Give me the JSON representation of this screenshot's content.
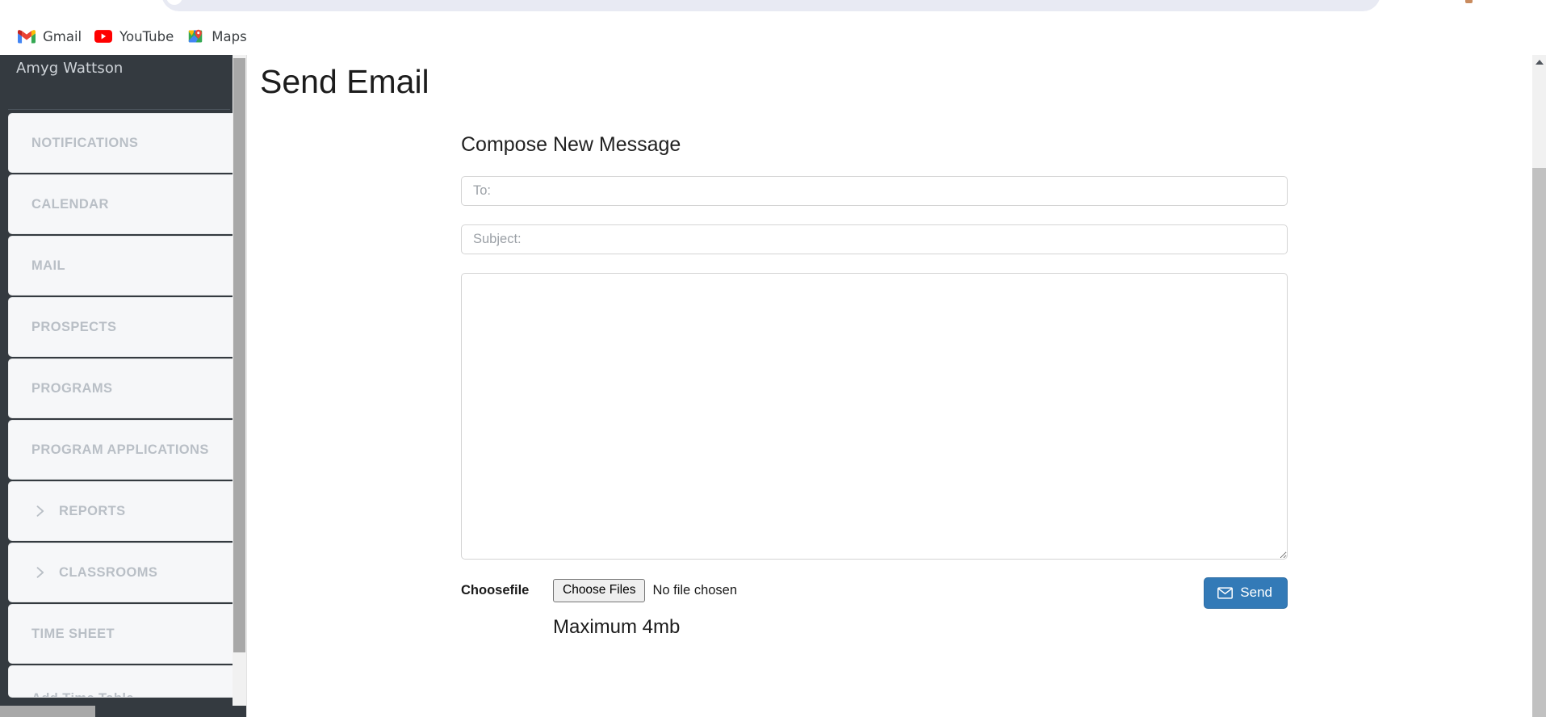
{
  "browser": {
    "bookmarks": [
      {
        "label": "Gmail",
        "icon": "gmail-icon"
      },
      {
        "label": "YouTube",
        "icon": "youtube-icon"
      },
      {
        "label": "Maps",
        "icon": "maps-icon"
      }
    ]
  },
  "sidebar": {
    "user": "Amyg Wattson",
    "items": [
      {
        "label": "NOTIFICATIONS",
        "expandable": false
      },
      {
        "label": "CALENDAR",
        "expandable": false
      },
      {
        "label": "MAIL",
        "expandable": false
      },
      {
        "label": "PROSPECTS",
        "expandable": false
      },
      {
        "label": "PROGRAMS",
        "expandable": false
      },
      {
        "label": "PROGRAM APPLICATIONS",
        "expandable": false
      },
      {
        "label": "REPORTS",
        "expandable": true
      },
      {
        "label": "CLASSROOMS",
        "expandable": true
      },
      {
        "label": "TIME SHEET",
        "expandable": false
      },
      {
        "label": "Add Time Table",
        "expandable": false
      }
    ]
  },
  "main": {
    "page_title": "Send Email",
    "compose": {
      "heading": "Compose New Message",
      "to": {
        "value": "",
        "placeholder": "To:"
      },
      "subject": {
        "value": "",
        "placeholder": "Subject:"
      },
      "body": {
        "value": "",
        "placeholder": ""
      },
      "attach_label": "Choosefile",
      "file_button": "Choose Files",
      "file_status": "No file chosen",
      "max_note": "Maximum 4mb",
      "send_label": "Send"
    }
  },
  "colors": {
    "sidebar_bg": "#343a40",
    "nav_card_bg": "#f6f7f9",
    "nav_label": "#b9bfc6",
    "send_button": "#337ab7",
    "send_button_border": "#2e6da4"
  }
}
